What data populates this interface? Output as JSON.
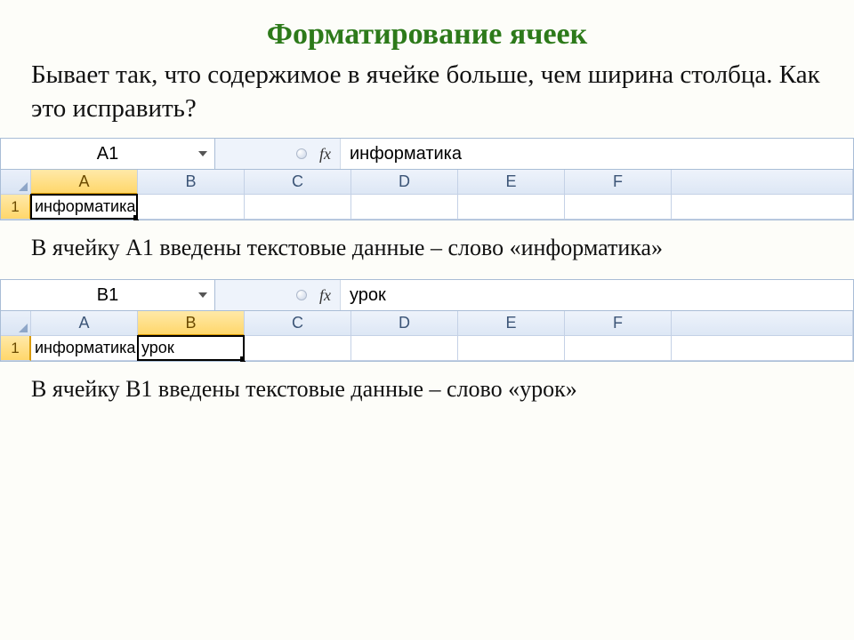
{
  "title": "Форматирование ячеек",
  "intro": "Бывает так, что содержимое в ячейке больше, чем ширина столбца. Как это исправить?",
  "caption1": "В ячейку А1 введены текстовые данные – слово «информатика»",
  "caption2": "В ячейку В1 введены текстовые данные – слово «урок»",
  "cols": [
    "A",
    "B",
    "C",
    "D",
    "E",
    "F"
  ],
  "snip1": {
    "name": "A1",
    "fxlabel": "fx",
    "formula": "информатика",
    "row": "1",
    "activeCol": "A",
    "a1": "информатика"
  },
  "snip2": {
    "name": "B1",
    "fxlabel": "fx",
    "formula": "урок",
    "row": "1",
    "activeCol": "B",
    "a1": "информатика",
    "b1": "урок"
  }
}
